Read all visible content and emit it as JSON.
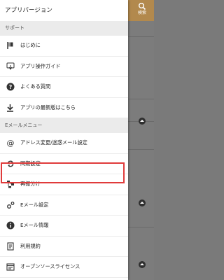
{
  "background": {
    "search_label": "検索"
  },
  "drawer": {
    "title": "アプリバージョン",
    "sections": [
      {
        "header": "サポート",
        "items": [
          {
            "label": "はじめに",
            "icon": "flag-icon"
          },
          {
            "label": "アプリ操作ガイド",
            "icon": "tap-guide-icon"
          },
          {
            "label": "よくある質問",
            "icon": "question-icon"
          },
          {
            "label": "アプリの最新版はこちら",
            "icon": "download-icon"
          }
        ]
      },
      {
        "header": "Eメールメニュー",
        "items": [
          {
            "label": "アドレス変更/迷惑メール設定",
            "icon": "at-sign-icon"
          },
          {
            "label": "同期設定",
            "icon": "sync-icon"
          },
          {
            "label": "再振分け",
            "icon": "resort-icon"
          },
          {
            "label": "Eメール設定",
            "icon": "settings-icon"
          },
          {
            "label": "Eメール情報",
            "icon": "info-icon"
          },
          {
            "label": "利用規約",
            "icon": "document-icon"
          },
          {
            "label": "オープンソースライセンス",
            "icon": "license-icon"
          }
        ]
      }
    ]
  },
  "colors": {
    "header_accent": "#b2894d",
    "highlight_border": "#e03b3b"
  }
}
